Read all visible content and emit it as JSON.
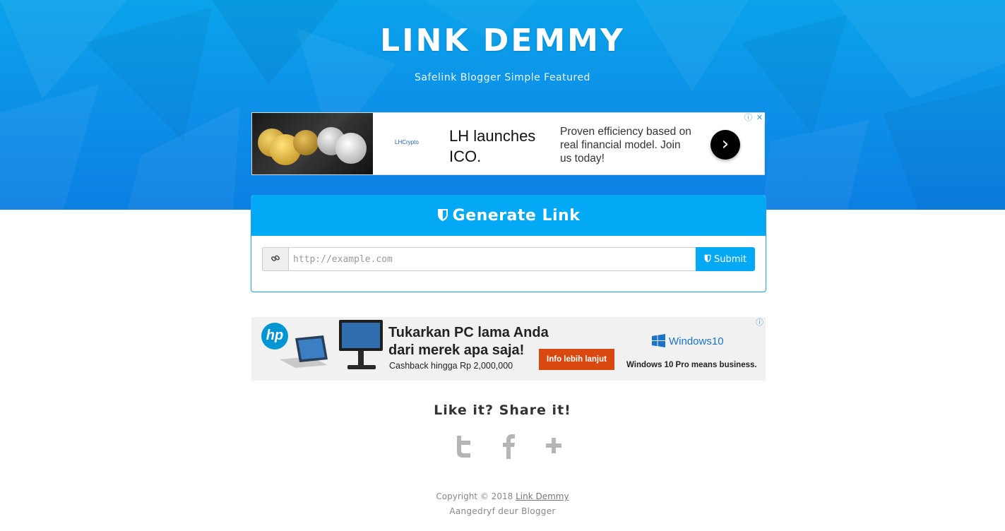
{
  "site": {
    "title": "LINK DEMMY",
    "subtitle": "Safelink Blogger Simple Featured",
    "brand_color": "#03a9f4"
  },
  "ad_top": {
    "logo_text": "LHCrypto",
    "headline": "LH launches ICO.",
    "body": "Proven efficiency based on real financial model. Join us today!",
    "cta_icon": "chevron-right-icon"
  },
  "generator": {
    "heading": "Generate Link",
    "heading_icon": "shield-icon",
    "addon_icon": "link-icon",
    "input_placeholder": "http://example.com",
    "input_value": "",
    "submit_label": "Submit"
  },
  "ad_bottom": {
    "brand": "hp",
    "headline": "Tukarkan PC lama Anda dari merek apa saja!",
    "cashback": "Cashback hingga Rp 2,000,000",
    "cta": "Info lebih lanjut",
    "os_brand": "Windows10",
    "os_tagline": "Windows 10 Pro means business."
  },
  "share": {
    "title": "Like it? Share it!",
    "icons": [
      "twitter-icon",
      "facebook-icon",
      "google-plus-icon"
    ]
  },
  "footer": {
    "copyright_prefix": "Copyright © 2018",
    "site_link": "Link Demmy",
    "powered_by": "Aangedryf deur Blogger"
  }
}
